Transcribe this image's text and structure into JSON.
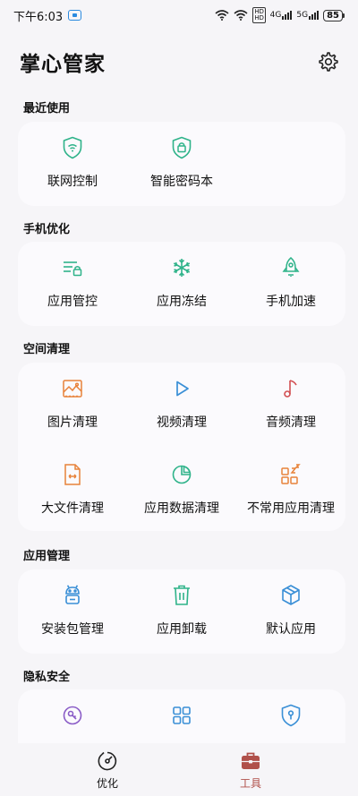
{
  "status_bar": {
    "time": "下午6:03",
    "net_tag": "HD\nHD",
    "net_tag_top": "HD",
    "net_tag_bottom": "HD",
    "sig1": "4G",
    "sig2": "5G",
    "battery": "85"
  },
  "header": {
    "title": "掌心管家"
  },
  "sections": [
    {
      "title": "最近使用",
      "items": [
        {
          "label": "联网控制",
          "icon": "wifi-shield-icon"
        },
        {
          "label": "智能密码本",
          "icon": "password-lock-icon"
        }
      ]
    },
    {
      "title": "手机优化",
      "items": [
        {
          "label": "应用管控",
          "icon": "app-control-icon"
        },
        {
          "label": "应用冻结",
          "icon": "snowflake-icon"
        },
        {
          "label": "手机加速",
          "icon": "rocket-icon"
        }
      ]
    },
    {
      "title": "空间清理",
      "items": [
        {
          "label": "图片清理",
          "icon": "image-icon"
        },
        {
          "label": "视频清理",
          "icon": "play-icon"
        },
        {
          "label": "音频清理",
          "icon": "music-note-icon"
        },
        {
          "label": "大文件清理",
          "icon": "large-file-icon"
        },
        {
          "label": "应用数据清理",
          "icon": "pie-chart-icon"
        },
        {
          "label": "不常用应用清理",
          "icon": "sleep-apps-icon"
        }
      ]
    },
    {
      "title": "应用管理",
      "items": [
        {
          "label": "安装包管理",
          "icon": "android-icon"
        },
        {
          "label": "应用卸载",
          "icon": "trash-icon"
        },
        {
          "label": "默认应用",
          "icon": "cube-icon"
        }
      ]
    },
    {
      "title": "隐私安全",
      "items": [
        {
          "label": "",
          "icon": "privacy-icon"
        },
        {
          "label": "",
          "icon": "grid-apps-icon"
        },
        {
          "label": "",
          "icon": "shield-key-icon"
        }
      ]
    }
  ],
  "bottom_nav": [
    {
      "label": "优化",
      "icon": "optimize-gauge-icon",
      "active": false
    },
    {
      "label": "工具",
      "icon": "toolbox-icon",
      "active": true
    }
  ],
  "colors": {
    "green": "#2fb38a",
    "blue": "#3a8fd6",
    "orange": "#e8823a",
    "red": "#d24f52",
    "active": "#b0504a"
  }
}
